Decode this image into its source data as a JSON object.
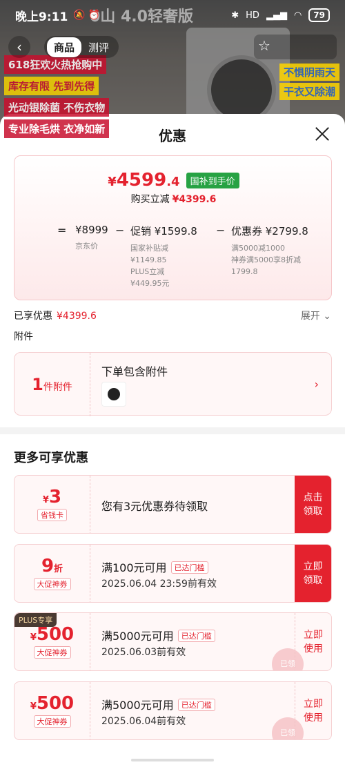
{
  "status_bar": {
    "time": "晚上9:11",
    "battery": "79",
    "network": "HD"
  },
  "background": {
    "banner_text": "0山 4.0轻奢版",
    "tabs": [
      "商品",
      "测评"
    ],
    "promo_left": [
      "618狂欢火热抢购中",
      "库存有限 先到先得",
      "光动银除菌 不伤衣物",
      "专业除毛烘 衣净如新"
    ],
    "promo_right": [
      "不惧阴雨天",
      "干衣又除潮"
    ]
  },
  "sheet": {
    "title": "优惠",
    "final_price": {
      "currency": "¥",
      "integer": "4599",
      "decimal": ".4"
    },
    "subsidy_tag": "国补到手价",
    "cut_label": "购买立减",
    "cut_amount": "¥4399.6",
    "breakdown": {
      "eq": "=",
      "minus": "−",
      "jd_price": "¥8999",
      "jd_label": "京东价",
      "promo_main": "促销 ¥1599.8",
      "promo_sub1": "国家补贴减",
      "promo_sub2": "¥1149.85",
      "promo_sub3": "PLUS立减",
      "promo_sub4": "¥449.95元",
      "coupon_main": "优惠券 ¥2799.8",
      "coupon_sub1": "满5000减1000",
      "coupon_sub2": "神券满5000享8折减",
      "coupon_sub3": "1799.8"
    },
    "enjoyed_label": "已享优惠",
    "enjoyed_amount": "¥4399.6",
    "expand_label": "展开",
    "accessories_label": "附件",
    "accessory": {
      "count": "1",
      "unit": "件附件",
      "title": "下单包含附件"
    },
    "more_title": "更多可享优惠",
    "coupons": [
      {
        "symbol": "¥",
        "value": "3",
        "suffix": "",
        "type": "省钱卡",
        "condition": "您有3元优惠券待领取",
        "date": "",
        "reach": "",
        "action_line1": "点击",
        "action_line2": "领取",
        "plus": ""
      },
      {
        "symbol": "",
        "value": "9",
        "suffix": "折",
        "type": "大促神券",
        "condition": "满100元可用",
        "date": "2025.06.04 23:59前有效",
        "reach": "已达门槛",
        "action_line1": "立即",
        "action_line2": "领取",
        "plus": ""
      },
      {
        "symbol": "¥",
        "value": "500",
        "suffix": "",
        "type": "大促神券",
        "condition": "满5000元可用",
        "date": "2025.06.03前有效",
        "reach": "已达门槛",
        "action_line1": "立即",
        "action_line2": "使用",
        "plus": "PLUS专享"
      },
      {
        "symbol": "¥",
        "value": "500",
        "suffix": "",
        "type": "大促神券",
        "condition": "满5000元可用",
        "date": "2025.06.04前有效",
        "reach": "已达门槛",
        "action_line1": "立即",
        "action_line2": "使用",
        "plus": ""
      }
    ],
    "stamp_text": "已领"
  },
  "colors": {
    "accent": "#e4222e",
    "subsidy_green": "#27a243"
  }
}
